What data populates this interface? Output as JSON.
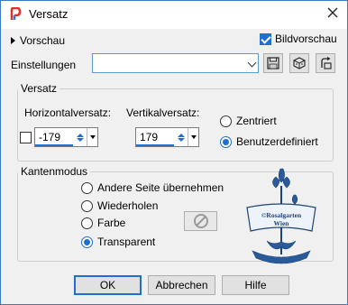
{
  "window": {
    "title": "Versatz",
    "close_glyph": "✕"
  },
  "preview": {
    "toggle_label": "Vorschau",
    "image_preview_label": "Bildvorschau",
    "image_preview_checked": true
  },
  "settings": {
    "label": "Einstellungen",
    "value": ""
  },
  "toolbar": {
    "icons": [
      "save-preset-icon",
      "reset-icon",
      "delete-preset-icon"
    ]
  },
  "offset": {
    "group_label": "Versatz",
    "horizontal_label": "Horizontalversatz:",
    "horizontal_value": "-179",
    "vertical_label": "Vertikalversatz:",
    "vertical_value": "179",
    "link_checked": false,
    "centered_label": "Zentriert",
    "custom_label": "Benutzerdefiniert",
    "selected": "custom"
  },
  "edge_mode": {
    "group_label": "Kantenmodus",
    "options": [
      "Andere Seite übernehmen",
      "Wiederholen",
      "Farbe",
      "Transparent"
    ],
    "selected": "Transparent"
  },
  "watermark": {
    "line1": "©Rosalgarten",
    "line2": "Wien"
  },
  "buttons": {
    "ok": "OK",
    "cancel": "Abbrechen",
    "help": "Hilfe"
  },
  "colors": {
    "accent": "#1e6fd0",
    "window_border": "#3c78c4",
    "watermark": "#2a5a9a",
    "app_icon_red": "#d9342b",
    "app_icon_blue": "#2b7bd9"
  }
}
